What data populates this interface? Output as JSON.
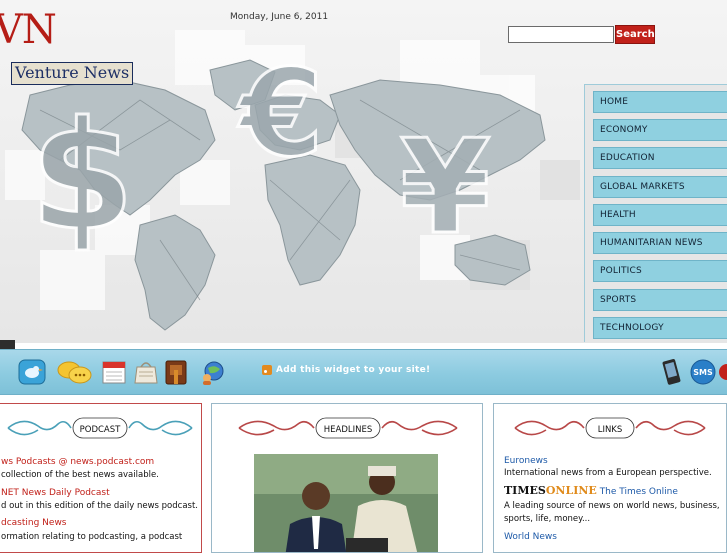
{
  "header": {
    "date": "Monday, June 6, 2011",
    "logo_mark": "VN",
    "logo_text": "Venture News",
    "search_placeholder": "",
    "search_button": "Search"
  },
  "menu": [
    {
      "label": "HOME"
    },
    {
      "label": "ECONOMY"
    },
    {
      "label": "EDUCATION"
    },
    {
      "label": "GLOBAL MARKETS"
    },
    {
      "label": "HEALTH"
    },
    {
      "label": "HUMANITARIAN NEWS"
    },
    {
      "label": "POLITICS"
    },
    {
      "label": "SPORTS"
    },
    {
      "label": "TECHNOLOGY"
    }
  ],
  "toolbar": {
    "widget_text": "Add this widget to your site!",
    "sms_label": "SMS",
    "icons": [
      "twitter-icon",
      "chat-icon",
      "calendar-icon",
      "notes-icon",
      "book-icon",
      "globe-user-icon",
      "phone-icon",
      "sms-icon"
    ]
  },
  "podcast": {
    "heading": "PODCAST",
    "items": [
      {
        "title": "ws Podcasts @ news.podcast.com",
        "desc": "collection of the best news available."
      },
      {
        "title": "NET News Daily Podcast",
        "desc": "d out in this edition of the daily news podcast."
      },
      {
        "title": "dcasting News",
        "desc": "ormation relating to podcasting, a podcast"
      }
    ]
  },
  "headlines": {
    "heading": "HEADLINES"
  },
  "links": {
    "heading": "LINKS",
    "items": [
      {
        "title": "Euronews",
        "desc": "International news from a European perspective."
      },
      {
        "logo_a": "TIMES",
        "logo_b": "ONLINE",
        "title": "The Times Online",
        "desc": "A leading source of news on world news, business, sports, life, money..."
      },
      {
        "title": "World News",
        "desc": ""
      }
    ]
  },
  "colors": {
    "brand_red": "#c1211a",
    "menu_blue": "#8fd0e0",
    "toolbar_blue": "#8ccbe0",
    "link_blue": "#1e5aa8"
  }
}
